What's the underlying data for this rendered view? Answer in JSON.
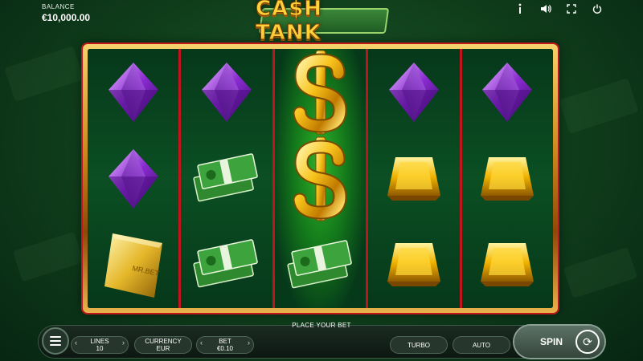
{
  "hud": {
    "balance_label": "BALANCE",
    "balance_value": "€10,000.00",
    "icons": [
      "info-icon",
      "sound-icon",
      "fullscreen-icon",
      "power-icon"
    ]
  },
  "logo": {
    "text": "CA$H TANK"
  },
  "reels": [
    [
      "purple-gem",
      "purple-gem",
      "gold-bar"
    ],
    [
      "purple-gem",
      "cash-stack",
      "cash-stack"
    ],
    [
      "dollar-sign",
      "dollar-sign",
      "cash-stack"
    ],
    [
      "purple-gem",
      "gold-gem",
      "gold-gem"
    ],
    [
      "purple-gem",
      "gold-gem",
      "gold-gem"
    ]
  ],
  "gold_bar_text": "MR.BET",
  "controls": {
    "place_your_bet": "PLACE YOUR BET",
    "lines_label": "LINES",
    "lines_value": "10",
    "currency_label": "CURRENCY",
    "currency_value": "EUR",
    "bet_label": "BET",
    "bet_value": "€0.10",
    "turbo_label": "TURBO",
    "auto_label": "AUTO",
    "spin_label": "SPIN"
  },
  "colors": {
    "frame_gold": "#c98a1d",
    "divider_red": "#c0161b",
    "win_green": "#2fb329",
    "logo_gold": "#ffd23a"
  }
}
